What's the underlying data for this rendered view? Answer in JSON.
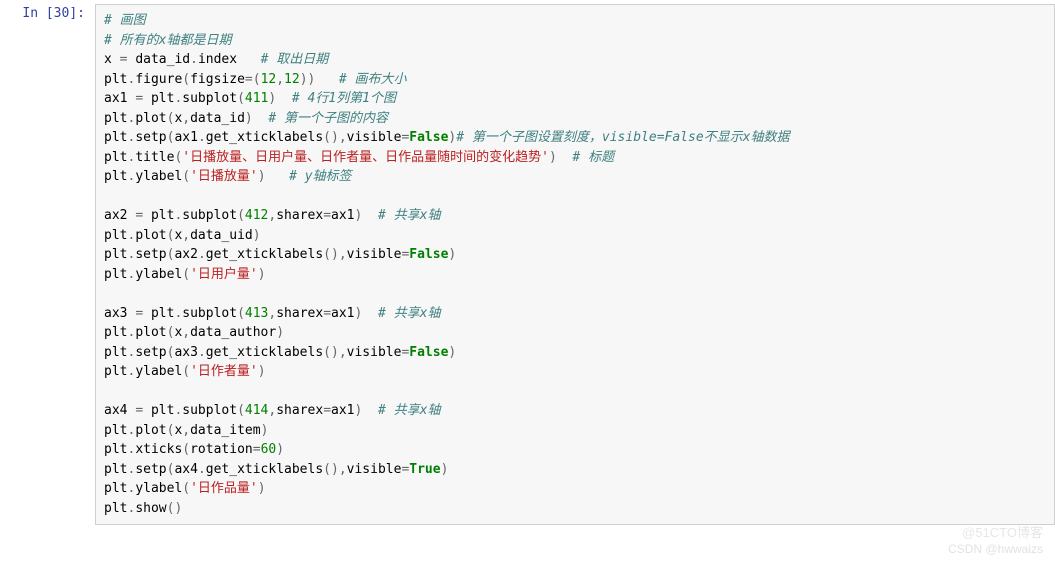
{
  "prompt": "In  [30]:",
  "watermark_top": "@51CTO博客",
  "watermark_bottom": "CSDN @hwwaizs",
  "lines": [
    {
      "t": "comment",
      "text": "# 画图"
    },
    {
      "t": "comment",
      "text": "# 所有的x轴都是日期"
    },
    {
      "t": "code",
      "segs": [
        {
          "k": "n",
          "v": "x "
        },
        {
          "k": "op",
          "v": "= "
        },
        {
          "k": "n",
          "v": "data_id"
        },
        {
          "k": "op",
          "v": "."
        },
        {
          "k": "n",
          "v": "index   "
        },
        {
          "k": "c",
          "v": "# 取出日期"
        }
      ]
    },
    {
      "t": "code",
      "segs": [
        {
          "k": "n",
          "v": "plt"
        },
        {
          "k": "op",
          "v": "."
        },
        {
          "k": "n",
          "v": "figure"
        },
        {
          "k": "op",
          "v": "("
        },
        {
          "k": "n",
          "v": "figsize"
        },
        {
          "k": "op",
          "v": "=("
        },
        {
          "k": "num",
          "v": "12"
        },
        {
          "k": "op",
          "v": ","
        },
        {
          "k": "num",
          "v": "12"
        },
        {
          "k": "op",
          "v": "))   "
        },
        {
          "k": "c",
          "v": "# 画布大小"
        }
      ]
    },
    {
      "t": "code",
      "segs": [
        {
          "k": "n",
          "v": "ax1 "
        },
        {
          "k": "op",
          "v": "= "
        },
        {
          "k": "n",
          "v": "plt"
        },
        {
          "k": "op",
          "v": "."
        },
        {
          "k": "n",
          "v": "subplot"
        },
        {
          "k": "op",
          "v": "("
        },
        {
          "k": "num",
          "v": "411"
        },
        {
          "k": "op",
          "v": ")  "
        },
        {
          "k": "c",
          "v": "# 4行1列第1个图"
        }
      ]
    },
    {
      "t": "code",
      "segs": [
        {
          "k": "n",
          "v": "plt"
        },
        {
          "k": "op",
          "v": "."
        },
        {
          "k": "n",
          "v": "plot"
        },
        {
          "k": "op",
          "v": "("
        },
        {
          "k": "n",
          "v": "x"
        },
        {
          "k": "op",
          "v": ","
        },
        {
          "k": "n",
          "v": "data_id"
        },
        {
          "k": "op",
          "v": ")  "
        },
        {
          "k": "c",
          "v": "# 第一个子图的内容"
        }
      ]
    },
    {
      "t": "code",
      "segs": [
        {
          "k": "n",
          "v": "plt"
        },
        {
          "k": "op",
          "v": "."
        },
        {
          "k": "n",
          "v": "setp"
        },
        {
          "k": "op",
          "v": "("
        },
        {
          "k": "n",
          "v": "ax1"
        },
        {
          "k": "op",
          "v": "."
        },
        {
          "k": "n",
          "v": "get_xticklabels"
        },
        {
          "k": "op",
          "v": "(),"
        },
        {
          "k": "n",
          "v": "visible"
        },
        {
          "k": "op",
          "v": "="
        },
        {
          "k": "kw",
          "v": "False"
        },
        {
          "k": "op",
          "v": ")"
        },
        {
          "k": "c",
          "v": "# 第一个子图设置刻度，visible=False不显示x轴数据"
        }
      ]
    },
    {
      "t": "code",
      "segs": [
        {
          "k": "n",
          "v": "plt"
        },
        {
          "k": "op",
          "v": "."
        },
        {
          "k": "n",
          "v": "title"
        },
        {
          "k": "op",
          "v": "("
        },
        {
          "k": "str",
          "v": "'日播放量、日用户量、日作者量、日作品量随时间的变化趋势'"
        },
        {
          "k": "op",
          "v": ")  "
        },
        {
          "k": "c",
          "v": "# 标题"
        }
      ]
    },
    {
      "t": "code",
      "segs": [
        {
          "k": "n",
          "v": "plt"
        },
        {
          "k": "op",
          "v": "."
        },
        {
          "k": "n",
          "v": "ylabel"
        },
        {
          "k": "op",
          "v": "("
        },
        {
          "k": "str",
          "v": "'日播放量'"
        },
        {
          "k": "op",
          "v": ")   "
        },
        {
          "k": "c",
          "v": "# y轴标签"
        }
      ]
    },
    {
      "t": "blank",
      "text": ""
    },
    {
      "t": "code",
      "segs": [
        {
          "k": "n",
          "v": "ax2 "
        },
        {
          "k": "op",
          "v": "= "
        },
        {
          "k": "n",
          "v": "plt"
        },
        {
          "k": "op",
          "v": "."
        },
        {
          "k": "n",
          "v": "subplot"
        },
        {
          "k": "op",
          "v": "("
        },
        {
          "k": "num",
          "v": "412"
        },
        {
          "k": "op",
          "v": ","
        },
        {
          "k": "n",
          "v": "sharex"
        },
        {
          "k": "op",
          "v": "="
        },
        {
          "k": "n",
          "v": "ax1"
        },
        {
          "k": "op",
          "v": ")  "
        },
        {
          "k": "c",
          "v": "# 共享x轴"
        }
      ]
    },
    {
      "t": "code",
      "segs": [
        {
          "k": "n",
          "v": "plt"
        },
        {
          "k": "op",
          "v": "."
        },
        {
          "k": "n",
          "v": "plot"
        },
        {
          "k": "op",
          "v": "("
        },
        {
          "k": "n",
          "v": "x"
        },
        {
          "k": "op",
          "v": ","
        },
        {
          "k": "n",
          "v": "data_uid"
        },
        {
          "k": "op",
          "v": ")"
        }
      ]
    },
    {
      "t": "code",
      "segs": [
        {
          "k": "n",
          "v": "plt"
        },
        {
          "k": "op",
          "v": "."
        },
        {
          "k": "n",
          "v": "setp"
        },
        {
          "k": "op",
          "v": "("
        },
        {
          "k": "n",
          "v": "ax2"
        },
        {
          "k": "op",
          "v": "."
        },
        {
          "k": "n",
          "v": "get_xticklabels"
        },
        {
          "k": "op",
          "v": "(),"
        },
        {
          "k": "n",
          "v": "visible"
        },
        {
          "k": "op",
          "v": "="
        },
        {
          "k": "kw",
          "v": "False"
        },
        {
          "k": "op",
          "v": ")"
        }
      ]
    },
    {
      "t": "code",
      "segs": [
        {
          "k": "n",
          "v": "plt"
        },
        {
          "k": "op",
          "v": "."
        },
        {
          "k": "n",
          "v": "ylabel"
        },
        {
          "k": "op",
          "v": "("
        },
        {
          "k": "str",
          "v": "'日用户量'"
        },
        {
          "k": "op",
          "v": ")"
        }
      ]
    },
    {
      "t": "blank",
      "text": ""
    },
    {
      "t": "code",
      "segs": [
        {
          "k": "n",
          "v": "ax3 "
        },
        {
          "k": "op",
          "v": "= "
        },
        {
          "k": "n",
          "v": "plt"
        },
        {
          "k": "op",
          "v": "."
        },
        {
          "k": "n",
          "v": "subplot"
        },
        {
          "k": "op",
          "v": "("
        },
        {
          "k": "num",
          "v": "413"
        },
        {
          "k": "op",
          "v": ","
        },
        {
          "k": "n",
          "v": "sharex"
        },
        {
          "k": "op",
          "v": "="
        },
        {
          "k": "n",
          "v": "ax1"
        },
        {
          "k": "op",
          "v": ")  "
        },
        {
          "k": "c",
          "v": "# 共享x轴"
        }
      ]
    },
    {
      "t": "code",
      "segs": [
        {
          "k": "n",
          "v": "plt"
        },
        {
          "k": "op",
          "v": "."
        },
        {
          "k": "n",
          "v": "plot"
        },
        {
          "k": "op",
          "v": "("
        },
        {
          "k": "n",
          "v": "x"
        },
        {
          "k": "op",
          "v": ","
        },
        {
          "k": "n",
          "v": "data_author"
        },
        {
          "k": "op",
          "v": ")"
        }
      ]
    },
    {
      "t": "code",
      "segs": [
        {
          "k": "n",
          "v": "plt"
        },
        {
          "k": "op",
          "v": "."
        },
        {
          "k": "n",
          "v": "setp"
        },
        {
          "k": "op",
          "v": "("
        },
        {
          "k": "n",
          "v": "ax3"
        },
        {
          "k": "op",
          "v": "."
        },
        {
          "k": "n",
          "v": "get_xticklabels"
        },
        {
          "k": "op",
          "v": "(),"
        },
        {
          "k": "n",
          "v": "visible"
        },
        {
          "k": "op",
          "v": "="
        },
        {
          "k": "kw",
          "v": "False"
        },
        {
          "k": "op",
          "v": ")"
        }
      ]
    },
    {
      "t": "code",
      "segs": [
        {
          "k": "n",
          "v": "plt"
        },
        {
          "k": "op",
          "v": "."
        },
        {
          "k": "n",
          "v": "ylabel"
        },
        {
          "k": "op",
          "v": "("
        },
        {
          "k": "str",
          "v": "'日作者量'"
        },
        {
          "k": "op",
          "v": ")"
        }
      ]
    },
    {
      "t": "blank",
      "text": ""
    },
    {
      "t": "code",
      "segs": [
        {
          "k": "n",
          "v": "ax4 "
        },
        {
          "k": "op",
          "v": "= "
        },
        {
          "k": "n",
          "v": "plt"
        },
        {
          "k": "op",
          "v": "."
        },
        {
          "k": "n",
          "v": "subplot"
        },
        {
          "k": "op",
          "v": "("
        },
        {
          "k": "num",
          "v": "414"
        },
        {
          "k": "op",
          "v": ","
        },
        {
          "k": "n",
          "v": "sharex"
        },
        {
          "k": "op",
          "v": "="
        },
        {
          "k": "n",
          "v": "ax1"
        },
        {
          "k": "op",
          "v": ")  "
        },
        {
          "k": "c",
          "v": "# 共享x轴"
        }
      ]
    },
    {
      "t": "code",
      "segs": [
        {
          "k": "n",
          "v": "plt"
        },
        {
          "k": "op",
          "v": "."
        },
        {
          "k": "n",
          "v": "plot"
        },
        {
          "k": "op",
          "v": "("
        },
        {
          "k": "n",
          "v": "x"
        },
        {
          "k": "op",
          "v": ","
        },
        {
          "k": "n",
          "v": "data_item"
        },
        {
          "k": "op",
          "v": ")"
        }
      ]
    },
    {
      "t": "code",
      "segs": [
        {
          "k": "n",
          "v": "plt"
        },
        {
          "k": "op",
          "v": "."
        },
        {
          "k": "n",
          "v": "xticks"
        },
        {
          "k": "op",
          "v": "("
        },
        {
          "k": "n",
          "v": "rotation"
        },
        {
          "k": "op",
          "v": "="
        },
        {
          "k": "num",
          "v": "60"
        },
        {
          "k": "op",
          "v": ")"
        }
      ]
    },
    {
      "t": "code",
      "segs": [
        {
          "k": "n",
          "v": "plt"
        },
        {
          "k": "op",
          "v": "."
        },
        {
          "k": "n",
          "v": "setp"
        },
        {
          "k": "op",
          "v": "("
        },
        {
          "k": "n",
          "v": "ax4"
        },
        {
          "k": "op",
          "v": "."
        },
        {
          "k": "n",
          "v": "get_xticklabels"
        },
        {
          "k": "op",
          "v": "(),"
        },
        {
          "k": "n",
          "v": "visible"
        },
        {
          "k": "op",
          "v": "="
        },
        {
          "k": "kw",
          "v": "True"
        },
        {
          "k": "op",
          "v": ")"
        }
      ]
    },
    {
      "t": "code",
      "segs": [
        {
          "k": "n",
          "v": "plt"
        },
        {
          "k": "op",
          "v": "."
        },
        {
          "k": "n",
          "v": "ylabel"
        },
        {
          "k": "op",
          "v": "("
        },
        {
          "k": "str",
          "v": "'日作品量'"
        },
        {
          "k": "op",
          "v": ")"
        }
      ]
    },
    {
      "t": "code",
      "segs": [
        {
          "k": "n",
          "v": "plt"
        },
        {
          "k": "op",
          "v": "."
        },
        {
          "k": "n",
          "v": "show"
        },
        {
          "k": "op",
          "v": "()"
        }
      ]
    }
  ]
}
